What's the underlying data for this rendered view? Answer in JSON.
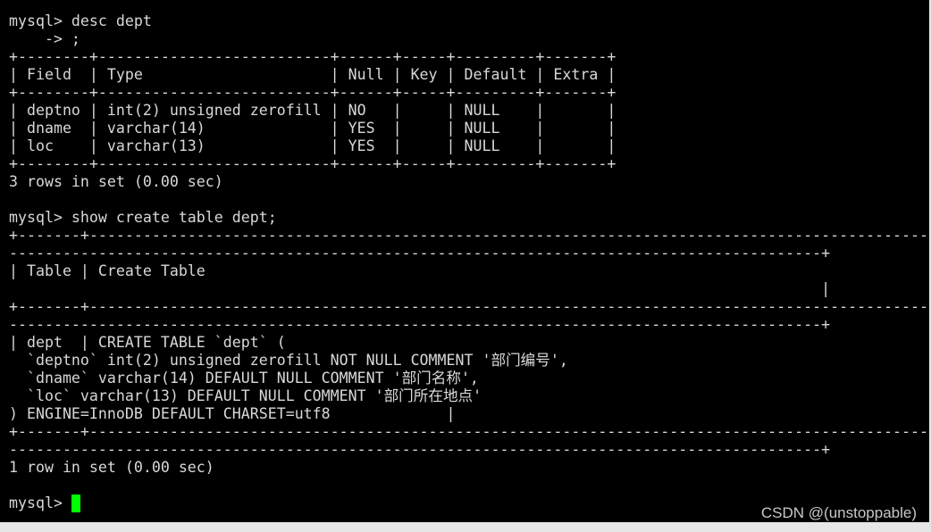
{
  "terminal": {
    "lines": [
      "mysql> desc dept",
      "    -> ;",
      "+--------+--------------------------+------+-----+---------+-------+",
      "| Field  | Type                     | Null | Key | Default | Extra |",
      "+--------+--------------------------+------+-----+---------+-------+",
      "| deptno | int(2) unsigned zerofill | NO   |     | NULL    |       |",
      "| dname  | varchar(14)              | YES  |     | NULL    |       |",
      "| loc    | varchar(13)              | YES  |     | NULL    |       |",
      "+--------+--------------------------+------+-----+---------+-------+",
      "3 rows in set (0.00 sec)",
      "",
      "mysql> show create table dept;",
      "+-------+-----------------------------------------------------------------------------------------------",
      "-------------------------------------------------------------------------------------------+",
      "| Table | Create Table",
      "                                                                                           |",
      "+-------+-----------------------------------------------------------------------------------------------",
      "-------------------------------------------------------------------------------------------+",
      "| dept  | CREATE TABLE `dept` (",
      "  `deptno` int(2) unsigned zerofill NOT NULL COMMENT '部门编号',",
      "  `dname` varchar(14) DEFAULT NULL COMMENT '部门名称',",
      "  `loc` varchar(13) DEFAULT NULL COMMENT '部门所在地点'",
      ") ENGINE=InnoDB DEFAULT CHARSET=utf8             |",
      "+-------+-----------------------------------------------------------------------------------------------",
      "-------------------------------------------------------------------------------------------+",
      "1 row in set (0.00 sec)",
      "",
      "mysql> "
    ],
    "cursor_color": "#00ff00",
    "background": "#000000"
  },
  "watermark": "CSDN @(unstoppable)"
}
